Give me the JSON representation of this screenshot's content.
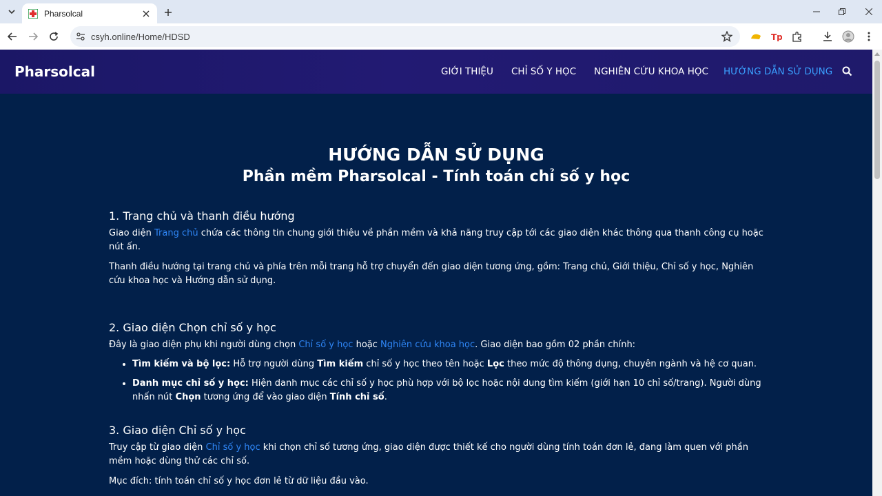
{
  "browser": {
    "tab_title": "Pharsolcal",
    "url": "csyh.online/Home/HDSD"
  },
  "site": {
    "brand": "Pharsolcal",
    "nav": [
      {
        "label": "GIỚI THIỆU",
        "active": false
      },
      {
        "label": "CHỈ SỐ Y HỌC",
        "active": false
      },
      {
        "label": "NGHIÊN CỨU KHOA HỌC",
        "active": false
      },
      {
        "label": "HƯỚNG DẪN SỬ DỤNG",
        "active": true
      }
    ]
  },
  "colors": {
    "page_bg": "#02204a",
    "header_bg": "#1f1a6b",
    "link": "#2f86f6",
    "nav_active": "#3aa0ff"
  },
  "hero": {
    "title": "HƯỚNG DẪN SỬ DỤNG",
    "subtitle": "Phần mềm Pharsolcal - Tính toán chỉ số y học"
  },
  "sections": {
    "s1": {
      "title": "1. Trang chủ và thanh điều hướng",
      "p1_pre": "Giao diện ",
      "p1_link": "Trang chủ",
      "p1_post": " chứa các thông tin chung giới thiệu về phần mềm và khả năng truy cập tới các giao diện khác thông qua thanh công cụ hoặc nút ấn.",
      "p2": "Thanh điều hướng tại trang chủ và phía trên mỗi trang hỗ trợ chuyển đến giao diện tương ứng, gồm: Trang chủ, Giới thiệu, Chỉ số y học, Nghiên cứu khoa học và Hướng dẫn sử dụng."
    },
    "s2": {
      "title": "2. Giao diện Chọn chỉ số y học",
      "p1_pre": "Đây là giao diện phụ khi người dùng chọn ",
      "p1_link1": "Chỉ số y học",
      "p1_mid": " hoặc ",
      "p1_link2": "Nghiên cứu khoa học",
      "p1_post": ". Giao diện bao gồm 02 phần chính:",
      "b1_bold": "Tìm kiếm và bộ lọc:",
      "b1_t1": " Hỗ trợ người dùng ",
      "b1_bold2": "Tìm kiếm",
      "b1_t2": " chỉ số y học theo tên hoặc ",
      "b1_bold3": "Lọc",
      "b1_t3": " theo mức độ thông dụng, chuyên ngành và hệ cơ quan.",
      "b2_bold": "Danh mục chỉ số y học:",
      "b2_t1": " Hiện danh mục các chỉ số y học phù hợp với bộ lọc hoặc nội dung tìm kiếm (giới hạn 10 chỉ số/trang). Người dùng nhấn nút ",
      "b2_bold2": "Chọn",
      "b2_t2": " tương ứng để vào giao diện ",
      "b2_bold3": "Tính chỉ số",
      "b2_t3": "."
    },
    "s3": {
      "title": "3. Giao diện Chỉ số y học",
      "p1_pre": "Truy cập từ giao diện ",
      "p1_link": "Chỉ số y học",
      "p1_post": " khi chọn chỉ số tương ứng, giao diện được thiết kế cho người dùng tính toán đơn lẻ, đang làm quen với phần mềm hoặc dùng thử các chỉ số.",
      "p2": "Mục đích: tính toán chỉ số y học đơn lẻ từ dữ liệu đầu vào."
    }
  }
}
